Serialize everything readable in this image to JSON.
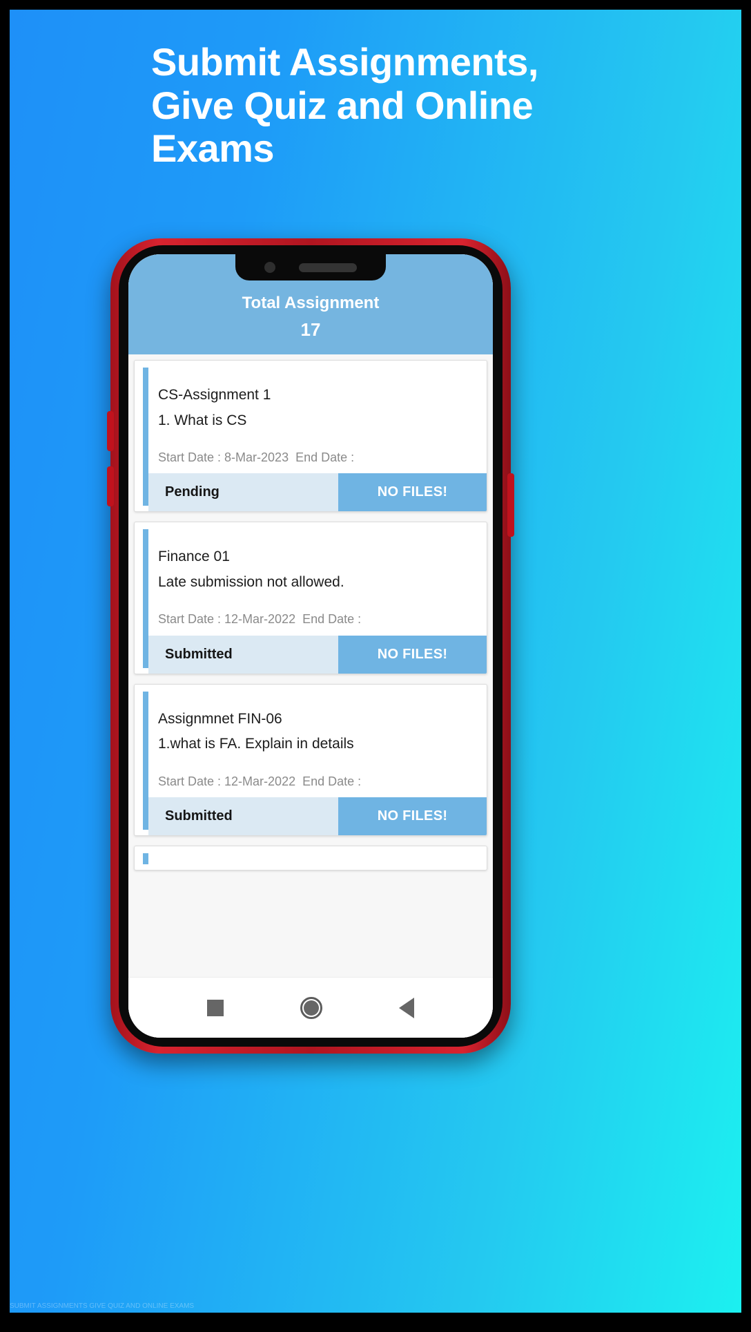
{
  "promo": {
    "headline_lines": [
      "Submit Assignments,",
      "Give Quiz and Online",
      "Exams"
    ],
    "background_from": "#1e90f8",
    "background_to": "#1cf0f0",
    "watermark": "SUBMIT ASSIGNMENTS GIVE QUIZ AND ONLINE EXAMS"
  },
  "phone": {
    "frame_color": "#c0121d",
    "body_color": "#0a0a0a",
    "notch": {
      "camera": "front-camera",
      "speaker": "earpiece-speaker"
    }
  },
  "app": {
    "appbar": {
      "title": "Total Assignment",
      "count": "17",
      "background": "#75b5e0"
    },
    "accent_color": "#6fb4e3",
    "status_background": "#dbe9f3",
    "assignments": [
      {
        "title": "CS-Assignment 1",
        "description": "1. What is CS",
        "dates": "Start Date : 8-Mar-2023  End Date :",
        "status": "Pending",
        "action": "NO FILES!"
      },
      {
        "title": "Finance 01",
        "description": "Late submission not allowed.",
        "dates": "Start Date : 12-Mar-2022  End Date :",
        "status": "Submitted",
        "action": "NO FILES!"
      },
      {
        "title": "Assignmnet FIN-06",
        "description": "1.what is FA. Explain in details",
        "dates": "Start Date : 12-Mar-2022  End Date :",
        "status": "Submitted",
        "action": "NO FILES!"
      }
    ],
    "navbar": {
      "recent_label": "recent-apps",
      "home_label": "home",
      "back_label": "back"
    }
  }
}
